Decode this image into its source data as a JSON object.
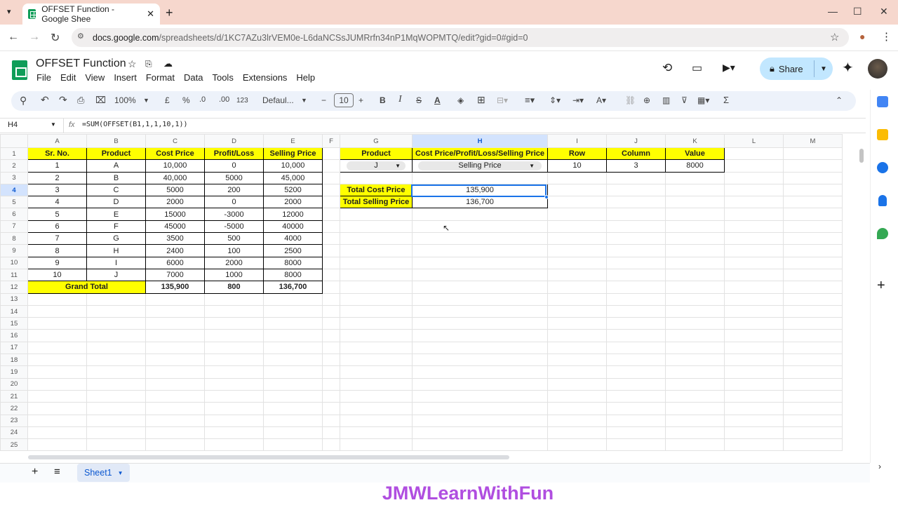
{
  "browser": {
    "tab_title": "OFFSET Function - Google Shee",
    "url_domain": "docs.google.com",
    "url_path": "/spreadsheets/d/1KC7AZu3lrVEM0e-L6daNCSsJUMRrfn34nP1MqWOPMTQ/edit?gid=0#gid=0"
  },
  "app": {
    "title": "OFFSET Function",
    "menus": [
      "File",
      "Edit",
      "View",
      "Insert",
      "Format",
      "Data",
      "Tools",
      "Extensions",
      "Help"
    ],
    "share_label": "Share"
  },
  "toolbar": {
    "zoom": "100%",
    "currency": "£",
    "percent": "%",
    "dec_minus": ".0",
    "dec_plus": ".00",
    "number_format": "123",
    "font": "Defaul...",
    "font_size": "10"
  },
  "formula_bar": {
    "name_box": "H4",
    "fx": "fx",
    "formula": "=SUM(OFFSET(B1,1,1,10,1))"
  },
  "grid": {
    "columns": [
      "A",
      "B",
      "C",
      "D",
      "E",
      "F",
      "G",
      "H",
      "I",
      "J",
      "K",
      "L",
      "M"
    ],
    "rows": [
      "1",
      "2",
      "3",
      "4",
      "5",
      "6",
      "7",
      "8",
      "9",
      "10",
      "11",
      "12",
      "13",
      "14",
      "15",
      "16",
      "17",
      "18",
      "19",
      "20",
      "21",
      "22",
      "23",
      "24",
      "25"
    ],
    "main_headers": [
      "Sr. No.",
      "Product",
      "Cost Price",
      "Profit/Loss",
      "Selling Price"
    ],
    "main_rows": [
      [
        "1",
        "A",
        "10,000",
        "0",
        "10,000"
      ],
      [
        "2",
        "B",
        "40,000",
        "5000",
        "45,000"
      ],
      [
        "3",
        "C",
        "5000",
        "200",
        "5200"
      ],
      [
        "4",
        "D",
        "2000",
        "0",
        "2000"
      ],
      [
        "5",
        "E",
        "15000",
        "-3000",
        "12000"
      ],
      [
        "6",
        "F",
        "45000",
        "-5000",
        "40000"
      ],
      [
        "7",
        "G",
        "3500",
        "500",
        "4000"
      ],
      [
        "8",
        "H",
        "2400",
        "100",
        "2500"
      ],
      [
        "9",
        "I",
        "6000",
        "2000",
        "8000"
      ],
      [
        "10",
        "J",
        "7000",
        "1000",
        "8000"
      ]
    ],
    "grand_total": {
      "label": "Grand Total",
      "cost": "135,900",
      "profit": "800",
      "selling": "136,700"
    },
    "lookup_headers": [
      "Product",
      "Cost Price/Profit/Loss/Selling Price",
      "Row",
      "Column",
      "Value"
    ],
    "lookup_values": {
      "product": "J",
      "field": "Selling Price",
      "row": "10",
      "column": "3",
      "value": "8000"
    },
    "totals": [
      {
        "label": "Total Cost Price",
        "value": "135,900"
      },
      {
        "label": "Total Selling Price",
        "value": "136,700"
      }
    ]
  },
  "sheet_tab": "Sheet1",
  "watermark": "JMWLearnWithFun",
  "colors": {
    "yellow": "#ffff00",
    "sheets_green": "#0f9d58",
    "selection": "#1a73e8",
    "watermark": "#b04ee0"
  }
}
